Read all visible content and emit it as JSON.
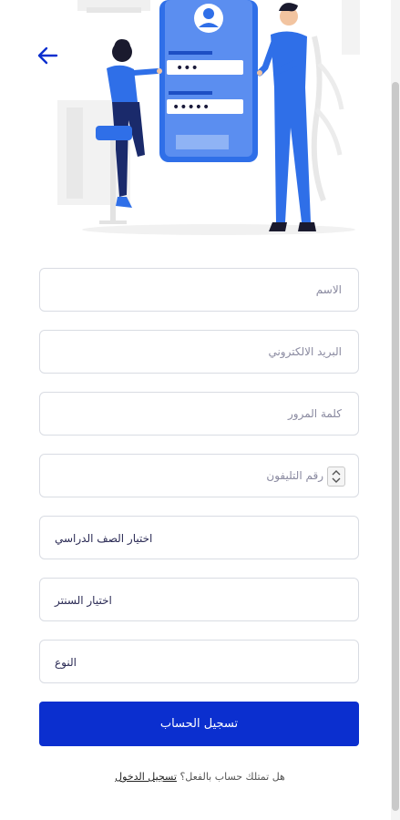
{
  "form": {
    "name_placeholder": "الاسم",
    "email_placeholder": "البريد الالكتروني",
    "password_placeholder": "كلمة المرور",
    "phone_placeholder": "رقم التليفون",
    "grade_value": "اختيار الصف الدراسي",
    "center_value": "اختيار السنتر",
    "gender_value": "النوع",
    "submit_label": "تسجيل الحساب"
  },
  "footer": {
    "question": "هل تمتلك حساب بالفعل؟",
    "login_link": "تسجيل الدخول"
  },
  "illustration": {
    "masked_password_short": "•••",
    "masked_password_long": "•••••"
  },
  "icons": {
    "back": "arrow-left-icon",
    "stepper": "number-stepper-icon"
  },
  "colors": {
    "primary": "#0b2fcf",
    "illustration_blue": "#2f6fe8",
    "field_border": "#d9dce3"
  }
}
